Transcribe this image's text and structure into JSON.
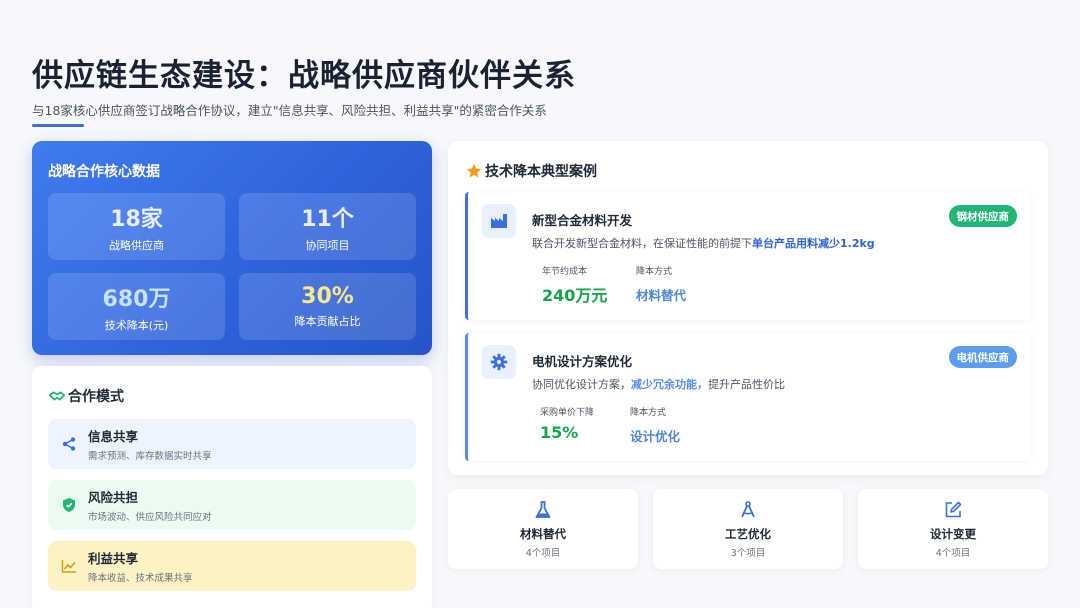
{
  "header": {
    "title": "供应链生态建设：战略供应商伙伴关系",
    "subtitle": "与18家核心供应商签订战略合作协议，建立\"信息共享、风险共担、利益共享\"的紧密合作关系"
  },
  "stats": {
    "title": "战略合作核心数据",
    "items": [
      {
        "value": "18家",
        "label": "战略供应商"
      },
      {
        "value": "11个",
        "label": "协同项目"
      },
      {
        "value": "680万",
        "label": "技术降本(元)"
      },
      {
        "value": "30%",
        "label": "降本贡献占比"
      }
    ]
  },
  "modes": {
    "title": "合作模式",
    "items": [
      {
        "title": "信息共享",
        "desc": "需求预测、库存数据实时共享",
        "icon": "share-icon"
      },
      {
        "title": "风险共担",
        "desc": "市场波动、供应风险共同应对",
        "icon": "shield-icon"
      },
      {
        "title": "利益共享",
        "desc": "降本收益、技术成果共享",
        "icon": "chart-line-icon"
      }
    ]
  },
  "cases": {
    "title": "技术降本典型案例",
    "items": [
      {
        "title": "新型合金材料开发",
        "desc_pre": "联合开发新型合金材料，在保证性能的前提下",
        "desc_hl": "单台产品用料减少1.2kg",
        "desc_post": "",
        "badge": "钢材供应商",
        "metric1_label": "年节约成本",
        "metric1_value": "240万元",
        "metric2_label": "降本方式",
        "metric2_value": "材料替代"
      },
      {
        "title": "电机设计方案优化",
        "desc_pre": "协同优化设计方案，",
        "desc_hl": "减少冗余功能",
        "desc_post": "，提升产品性价比",
        "badge": "电机供应商",
        "metric1_label": "采购单价下降",
        "metric1_value": "15%",
        "metric2_label": "降本方式",
        "metric2_value": "设计优化"
      }
    ]
  },
  "tiles": [
    {
      "title": "材料替代",
      "count": "4个项目",
      "icon": "flask-icon"
    },
    {
      "title": "工艺优化",
      "count": "3个项目",
      "icon": "drafting-compass-icon"
    },
    {
      "title": "设计变更",
      "count": "4个项目",
      "icon": "edit-icon"
    }
  ],
  "colors": {
    "primary": "#3b6fe0",
    "green": "#22b573",
    "yellow": "#fde68a"
  }
}
